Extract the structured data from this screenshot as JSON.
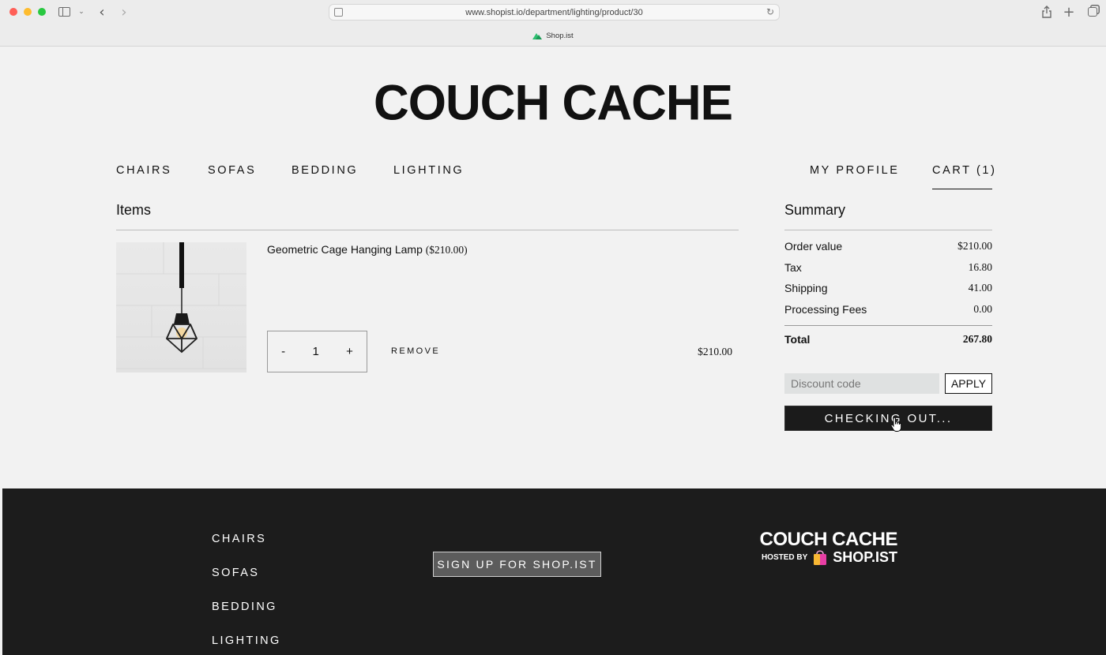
{
  "browser": {
    "url": "www.shopist.io/department/lighting/product/30",
    "tab_title": "Shop.ist"
  },
  "header": {
    "brand": "COUCH CACHE",
    "nav": [
      "CHAIRS",
      "SOFAS",
      "BEDDING",
      "LIGHTING"
    ],
    "profile": "MY PROFILE",
    "cart": "CART (1)"
  },
  "items": {
    "title": "Items",
    "list": [
      {
        "name": "Geometric Cage Hanging Lamp",
        "unit_price": "($210.00)",
        "qty_minus": "-",
        "quantity": "1",
        "qty_plus": "+",
        "remove": "REMOVE",
        "line_total": "$210.00"
      }
    ]
  },
  "summary": {
    "title": "Summary",
    "rows": [
      {
        "label": "Order value",
        "value": "$210.00"
      },
      {
        "label": "Tax",
        "value": "16.80"
      },
      {
        "label": "Shipping",
        "value": "41.00"
      },
      {
        "label": "Processing Fees",
        "value": "0.00"
      }
    ],
    "total_label": "Total",
    "total_value": "267.80",
    "discount_placeholder": "Discount code",
    "apply": "APPLY",
    "checkout": "CHECKING OUT..."
  },
  "footer": {
    "links": [
      "CHAIRS",
      "SOFAS",
      "BEDDING",
      "LIGHTING"
    ],
    "signup": "SIGN UP FOR SHOP.IST",
    "brand": "COUCH CACHE",
    "hosted_by": "HOSTED BY",
    "host": "SHOP.IST"
  },
  "colors": {
    "page_bg": "#f2f2f2",
    "footer_bg": "#1c1c1c",
    "checkout_bg": "#1b1b1b",
    "accent_green": "#2fbf71"
  }
}
